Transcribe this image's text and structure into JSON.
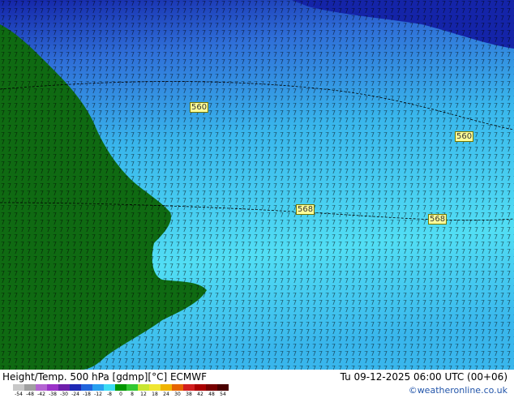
{
  "map": {
    "contour_labels": [
      "560",
      "560",
      "568",
      "568"
    ],
    "colors": {
      "land": "#0f6a12",
      "deep_blue": "#1424a8",
      "mid_blue": "#2f6fd8",
      "light_blue": "#39b6ec",
      "cyan": "#52def4"
    }
  },
  "footer": {
    "title": "Height/Temp. 500 hPa [gdmp][°C] ECMWF",
    "datetime": "Tu 09-12-2025 06:00 UTC (00+06)",
    "credit": "©weatheronline.co.uk"
  },
  "legend": {
    "ticks": [
      "-54",
      "-48",
      "-42",
      "-38",
      "-30",
      "-24",
      "-18",
      "-12",
      "-8",
      "0",
      "8",
      "12",
      "18",
      "24",
      "30",
      "38",
      "42",
      "48",
      "54"
    ],
    "colors": [
      "#c8c8c8",
      "#a0a0a0",
      "#b464d2",
      "#9b32c8",
      "#6e1eaa",
      "#1e28b4",
      "#2064dc",
      "#28a0f0",
      "#3cdcf4",
      "#009600",
      "#32c832",
      "#c8e632",
      "#f0e632",
      "#f0b400",
      "#e66400",
      "#d21e1e",
      "#aa0000",
      "#780000",
      "#4a0000"
    ]
  }
}
